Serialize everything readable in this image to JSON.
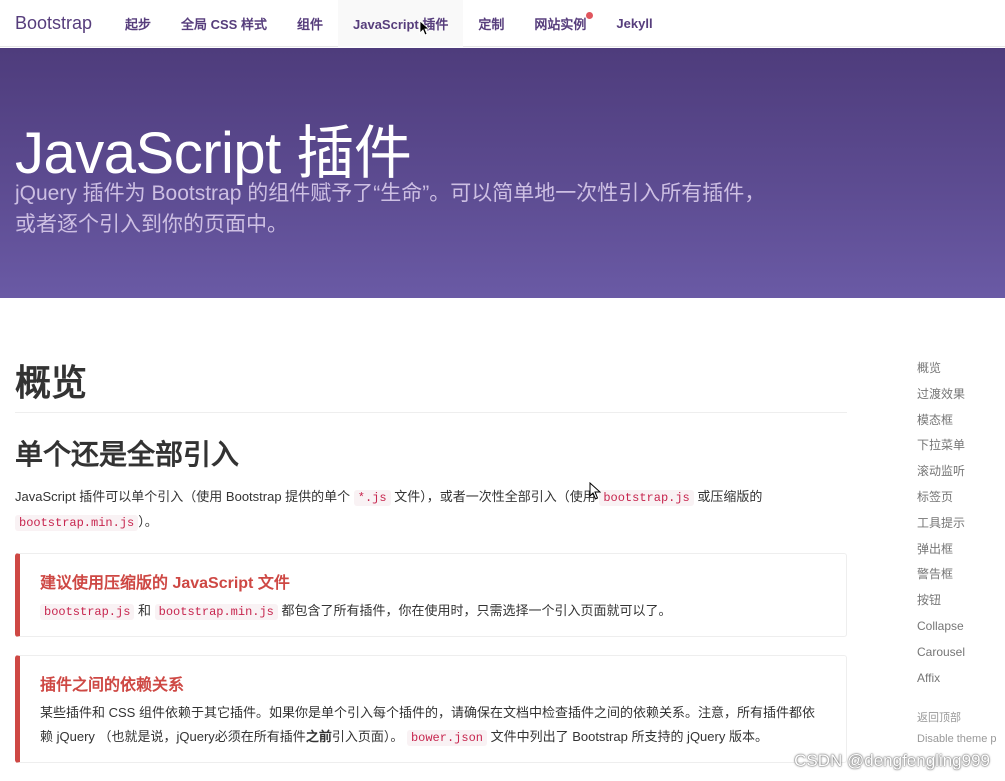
{
  "navbar": {
    "brand": "Bootstrap",
    "items": [
      {
        "label": "起步"
      },
      {
        "label": "全局 CSS 样式"
      },
      {
        "label": "组件"
      },
      {
        "label": "JavaScript 插件"
      },
      {
        "label": "定制"
      },
      {
        "label": "网站实例"
      },
      {
        "label": "Jekyll"
      }
    ],
    "active_index": 3
  },
  "jumbotron": {
    "title": "JavaScript 插件",
    "subtitle": "jQuery 插件为 Bootstrap 的组件赋予了“生命”。可以简单地一次性引入所有插件，或者逐个引入到你的页面中。"
  },
  "main": {
    "overview_heading": "概览",
    "single_heading": "单个还是全部引入",
    "intro": {
      "t1": "JavaScript 插件可以单个引入（使用 Bootstrap 提供的单个 ",
      "c1": "*.js",
      "t2": " 文件），或者一次性全部引入（使用 ",
      "c2": "bootstrap.js",
      "t3": " 或压缩版的 ",
      "c3": "bootstrap.min.js",
      "t4": "）。"
    },
    "callout1": {
      "title": "建议使用压缩版的 JavaScript 文件",
      "c1": "bootstrap.js",
      "t1": " 和 ",
      "c2": "bootstrap.min.js",
      "t2": " 都包含了所有插件，你在使用时，只需选择一个引入页面就可以了。"
    },
    "callout2": {
      "title": "插件之间的依赖关系",
      "t1": "某些插件和 CSS 组件依赖于其它插件。如果你是单个引入每个插件的，请确保在文档中检查插件之间的依赖关系。注意，所有插件都依赖 jQuery （也就是说，jQuery必须在所有插件",
      "strong": "之前",
      "t2": "引入页面）。 ",
      "c1": "bower.json",
      "t3": " 文件中列出了 Bootstrap 所支持的 jQuery 版本。"
    }
  },
  "sidenav": {
    "items": [
      "概览",
      "过渡效果",
      "模态框",
      "下拉菜单",
      "滚动监听",
      "标签页",
      "工具提示",
      "弹出框",
      "警告框",
      "按钮",
      "Collapse",
      "Carousel",
      "Affix"
    ],
    "back_to_top": "返回顶部",
    "theme_toggle": "Disable theme p"
  },
  "watermark": "CSDN @dengfengling999",
  "colors": {
    "brand": "#563d7c",
    "callout_border": "#ce4844",
    "code_text": "#c7254e",
    "code_bg": "#f9f2f4"
  }
}
